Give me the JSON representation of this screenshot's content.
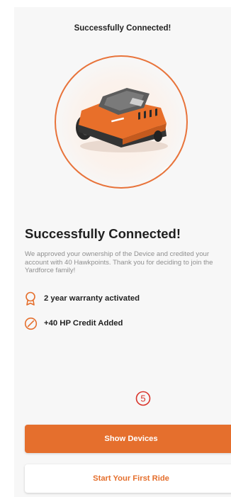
{
  "header": {
    "title": "Successfully Connected!"
  },
  "main": {
    "heading": "Successfully Connected!",
    "description": "We approved your ownership of the Device and credited your account with 40 Hawkpoints. Thank you for deciding to join the Yardforce family!",
    "features": [
      {
        "icon": "award-icon",
        "label": "2 year warranty activated"
      },
      {
        "icon": "slash-circle-icon",
        "label": "+40 HP Credit Added"
      }
    ],
    "step_indicator": "5"
  },
  "actions": {
    "primary_label": "Show Devices",
    "secondary_label": "Start Your First Ride"
  },
  "colors": {
    "accent": "#e56f2d",
    "success": "#199157",
    "background": "#f7f7f7"
  }
}
